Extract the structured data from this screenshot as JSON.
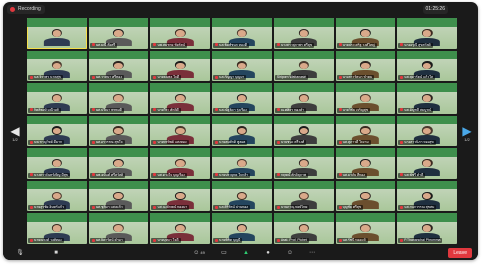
{
  "recording": {
    "label": "Recording"
  },
  "timer": {
    "value": "01:25:26"
  },
  "nav": {
    "left_page": "1/2",
    "right_page": "1/2"
  },
  "toolbar": {
    "participants_count": "49",
    "leave_label": "Leave"
  },
  "colors": {
    "leave": "#e0383e",
    "active_speaker": "#f5e04a",
    "banner": "#3e8f4c"
  },
  "tiles": [
    {
      "name": "",
      "active": true,
      "muted": false
    },
    {
      "name": "นส.มณี ตั้งศรี",
      "muted": true
    },
    {
      "name": "นพ.สมชาย ชัยรัตน์",
      "muted": true
    },
    {
      "name": "นส.พิมพ์ชนก ทองดี",
      "muted": true
    },
    {
      "name": "นางสาวสุภาพร ศรีสุข",
      "muted": true
    },
    {
      "name": "นายประเสริฐ วงศ์ใหญ่",
      "muted": true
    },
    {
      "name": "นางอรุณี สุขสวัสดิ์",
      "muted": true
    },
    {
      "name": "นส.จิราพร นาคสุข",
      "muted": true
    },
    {
      "name": "นส.วาสนา ศรีทอง",
      "muted": true
    },
    {
      "name": "นายธนพล ใจดี",
      "muted": true
    },
    {
      "name": "นส.กัญญา บุญมา",
      "muted": true
    },
    {
      "name": "Siriporn Wattanasiri",
      "muted": false
    },
    {
      "name": "นางสาวรัตนา ขำคม",
      "muted": true
    },
    {
      "name": "นส.สุดารัตน์ แก้วใส",
      "muted": true
    },
    {
      "name": "กิตติพงษ์ มณีวงศ์",
      "muted": true
    },
    {
      "name": "นส.ปวีณา พรหมดี",
      "muted": true
    },
    {
      "name": "นายวีระ ศักดิ์ดี",
      "muted": true
    },
    {
      "name": "นส.ณัฐธิดา รุ่งเรือง",
      "muted": true
    },
    {
      "name": "ณ.ศศิธร ทองคำ",
      "muted": true
    },
    {
      "name": "นายวิชัย เจริญสุข",
      "muted": true
    },
    {
      "name": "นส.อัญชลี สมบูรณ์",
      "muted": true
    },
    {
      "name": "นพ.ชาญวิทย์ ดีมาก",
      "muted": true
    },
    {
      "name": "นส.อรวรรณ สุขใจ",
      "muted": true
    },
    {
      "name": "นางพรทิพย์ แสงทอง",
      "muted": true
    },
    {
      "name": "นายสมศักดิ์ พูลผล",
      "muted": true
    },
    {
      "name": "นายชนะ ศรีวงศ์",
      "muted": true
    },
    {
      "name": "นส.สุภาวดี ใจงาม",
      "muted": true
    },
    {
      "name": "นางสาวนิภา ทองสุข",
      "muted": true
    },
    {
      "name": "นางสาวจันทร์เพ็ญ มีสุข",
      "muted": true
    },
    {
      "name": "นพ.อนันต์ ศรีสวัสดิ์",
      "muted": true
    },
    {
      "name": "นส.ดวงใจ บุญเรือง",
      "muted": true
    },
    {
      "name": "นายประยุทธ ใจกล้า",
      "muted": true
    },
    {
      "name": "กฤษณ์ ศักดิ์สุภาพ",
      "muted": true
    },
    {
      "name": "นส.มาลัย สีทอง",
      "muted": true
    },
    {
      "name": "นส.พัชรี คำดี",
      "muted": true
    },
    {
      "name": "นายสุรชัย อินทร์แก้ว",
      "muted": true
    },
    {
      "name": "นส.ชุติมา แสงแก้ว",
      "muted": true
    },
    {
      "name": "นส.นงลักษณ์ ทองมา",
      "muted": true
    },
    {
      "name": "นส.ศิริรัตน์ ปานทอง",
      "muted": true
    },
    {
      "name": "นายภาณุ พงษ์ไทย",
      "muted": true
    },
    {
      "name": "บุญชัย ศรีสุข",
      "muted": true
    },
    {
      "name": "นส.กนกวรรณ สุขสม",
      "muted": true
    },
    {
      "name": "นายณรงค์ วงศ์ทอง",
      "muted": true
    },
    {
      "name": "นส.ธิดารัตน์ คำมา",
      "muted": true
    },
    {
      "name": "นางบุษบา ใจดี",
      "muted": true
    },
    {
      "name": "นายพิชิต บุญมี",
      "muted": true
    },
    {
      "name": "Asst. Prof. Pichet",
      "muted": true
    },
    {
      "name": "นส.รัชนี ทองแท้",
      "muted": true
    },
    {
      "name": "P.Thananchai Phromma",
      "muted": true
    }
  ]
}
